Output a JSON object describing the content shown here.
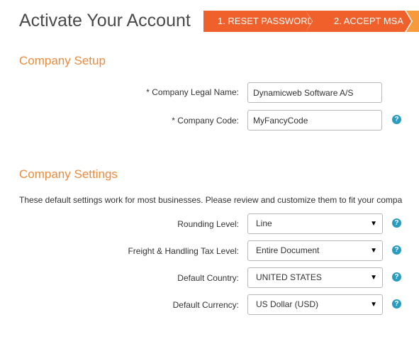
{
  "header": {
    "title": "Activate Your Account",
    "steps": [
      {
        "label": "1. RESET PASSWORD"
      },
      {
        "label": "2. ACCEPT MSA"
      }
    ]
  },
  "company_setup": {
    "title": "Company Setup",
    "legal_name_label": "* Company Legal Name:",
    "legal_name_value": "Dynamicweb Software A/S",
    "code_label": "* Company Code:",
    "code_value": "MyFancyCode"
  },
  "company_settings": {
    "title": "Company Settings",
    "intro": "These default settings work for most businesses. Please review and customize them to fit your compa",
    "rounding_label": "Rounding Level:",
    "rounding_value": "Line",
    "freight_label": "Freight & Handling Tax Level:",
    "freight_value": "Entire Document",
    "country_label": "Default Country:",
    "country_value": "UNITED STATES",
    "currency_label": "Default Currency:",
    "currency_value": "US Dollar (USD)"
  },
  "icons": {
    "help": "?",
    "caret": "▼"
  },
  "colors": {
    "step_active": "#f0602b",
    "step_next": "#f79a3b",
    "section_title": "#ef8a3c",
    "help_icon": "#2a9cbd"
  }
}
